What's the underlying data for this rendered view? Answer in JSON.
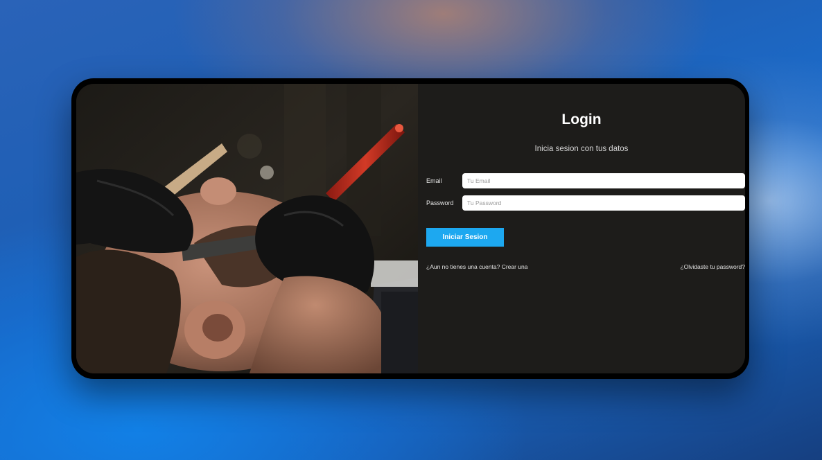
{
  "login": {
    "title": "Login",
    "subtitle": "Inicia sesion con tus datos",
    "email": {
      "label": "Email",
      "placeholder": "Tu Email",
      "value": ""
    },
    "password": {
      "label": "Password",
      "placeholder": "Tu Password",
      "value": ""
    },
    "submit_label": "Iniciar Sesion",
    "register_link": "¿Aun no tienes una cuenta? Crear una",
    "forgot_link": "¿Olvidaste tu password?"
  },
  "colors": {
    "panel_background": "#1d1c1a",
    "accent": "#1da8f0",
    "text": "#ffffff"
  },
  "icons": {
    "hero": "barber-shaving-photo"
  }
}
